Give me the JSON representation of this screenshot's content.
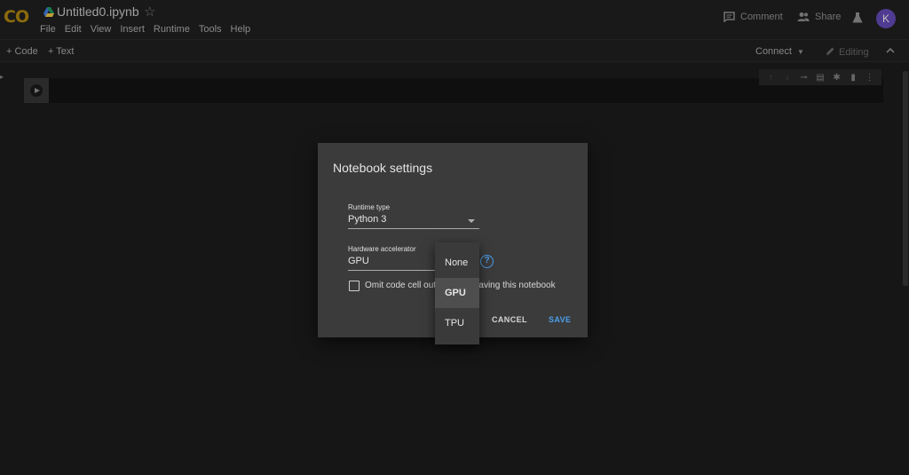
{
  "app": {
    "logo_text": "CO",
    "notebook_title": "Untitled0.ipynb",
    "avatar_letter": "K",
    "accent_color": "#4a9eea"
  },
  "menubar": {
    "items": [
      "File",
      "Edit",
      "View",
      "Insert",
      "Runtime",
      "Tools",
      "Help"
    ]
  },
  "header_actions": {
    "comment_label": "Comment",
    "share_label": "Share"
  },
  "toolbar": {
    "add_code_label": "+ Code",
    "add_text_label": "+ Text",
    "connect_label": "Connect",
    "editing_label": "Editing"
  },
  "dialog": {
    "title": "Notebook settings",
    "runtime_type_label": "Runtime type",
    "runtime_type_value": "Python 3",
    "hardware_label": "Hardware accelerator",
    "hardware_value": "GPU",
    "omit_output_label": "Omit code cell output when saving this notebook",
    "omit_output_checked": false,
    "cancel_label": "CANCEL",
    "save_label": "SAVE"
  },
  "hardware_dropdown": {
    "options": [
      "None",
      "GPU",
      "TPU"
    ],
    "highlighted": "GPU"
  }
}
